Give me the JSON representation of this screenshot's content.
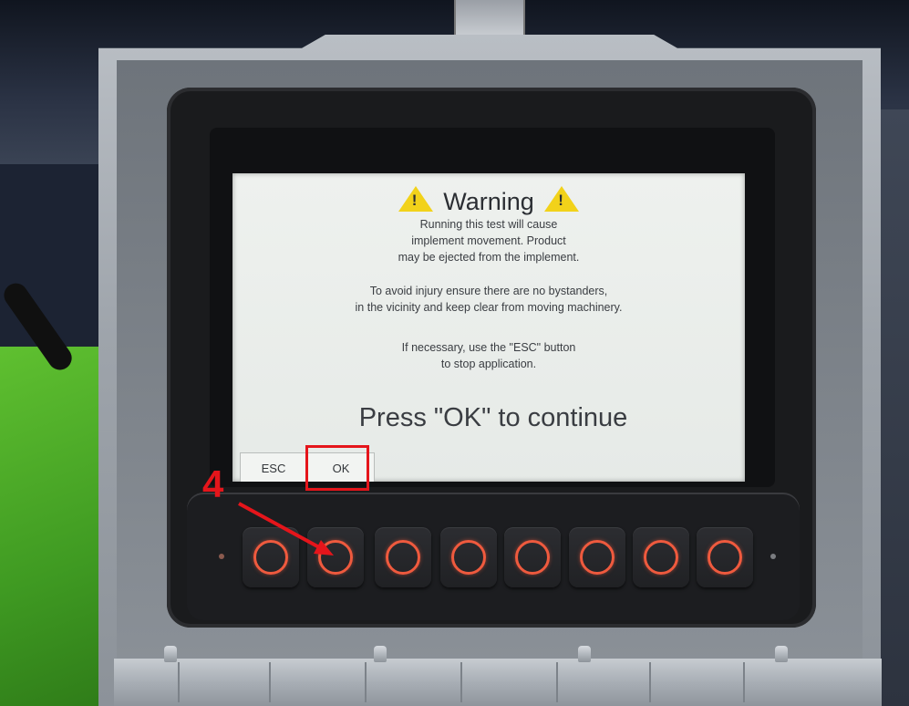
{
  "dialog": {
    "title": "Warning",
    "paragraph1": [
      "Running this test will cause",
      "implement movement. Product",
      "may be ejected from the implement."
    ],
    "paragraph2": [
      "To avoid injury ensure there are no bystanders,",
      "in the vicinity and keep clear from moving machinery."
    ],
    "paragraph3": [
      "If necessary, use the \"ESC\" button",
      "to stop application."
    ],
    "prompt": "Press \"OK\" to continue"
  },
  "softkeys": {
    "esc_label": "ESC",
    "ok_label": "OK"
  },
  "annotation": {
    "step_number": "4",
    "color": "#e5151b"
  },
  "hardware_buttons": {
    "count": 8,
    "ring_color": "#ef5a3e"
  },
  "colors": {
    "warning_triangle": "#f2d21a",
    "screen_background": "#eef1ee"
  }
}
